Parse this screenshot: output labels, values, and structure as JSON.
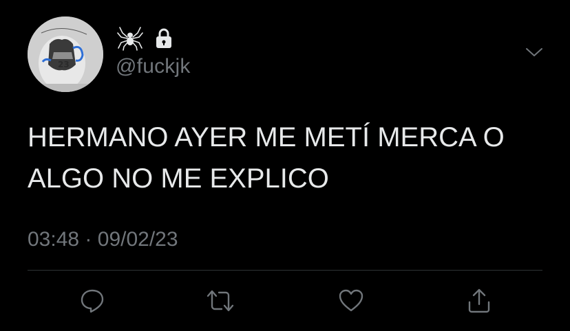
{
  "tweet": {
    "user": {
      "handle": "@fuckjk",
      "name_icon": "spider-icon",
      "protected_icon": "lock-icon",
      "avatar_icon": "avatar-photo"
    },
    "text_lines": [
      "HERMANO AYER ME METÍ MERCA O",
      "ALGO NO ME EXPLICO"
    ],
    "time": "03:48",
    "separator": "·",
    "date": "09/02/23",
    "actions": [
      {
        "name": "reply",
        "icon": "comment-icon"
      },
      {
        "name": "retweet",
        "icon": "retweet-icon"
      },
      {
        "name": "like",
        "icon": "heart-icon"
      },
      {
        "name": "share",
        "icon": "share-icon"
      }
    ],
    "colors": {
      "background": "#000000",
      "text": "#e7e9ea",
      "secondary": "#71767b",
      "divider": "#2f3336"
    }
  }
}
